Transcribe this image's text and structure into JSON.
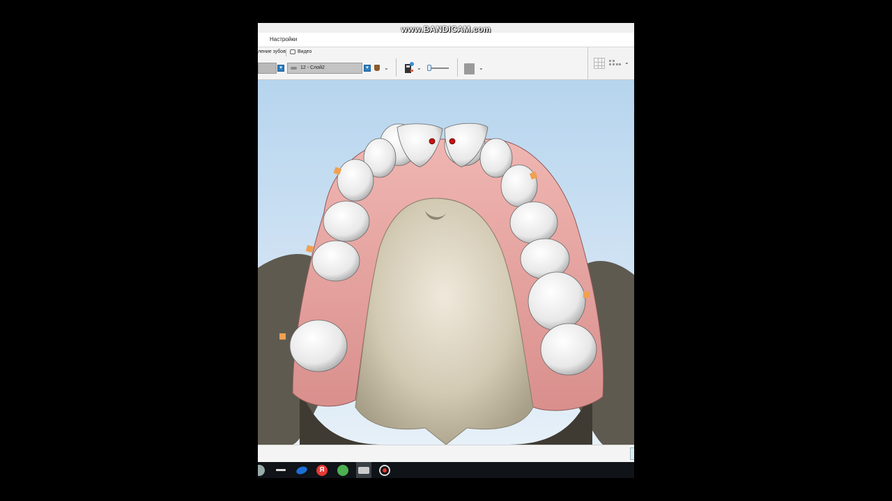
{
  "watermark": "www.BANDICAM.com",
  "menu": {
    "settings": "Настройки"
  },
  "ribbon": {
    "tabs": [
      "ление зубов",
      "Видео"
    ],
    "layer_select": "12 - Слой2"
  },
  "viewport": {
    "background_top": "#b6d5ee",
    "background_bottom": "#e6f0f8",
    "gum_color": "#e8a8a4",
    "tooth_color": "#f4f4f4",
    "palate_color": "#cfc6b0",
    "marker_orange": "#f0a050",
    "marker_red": "#cc1111"
  },
  "taskbar": {
    "icons": [
      "app-icon",
      "dash-icon",
      "browser-icon",
      "yandex-icon",
      "utorrent-icon",
      "window-icon",
      "record-icon"
    ],
    "yandex_letter": "Я"
  }
}
